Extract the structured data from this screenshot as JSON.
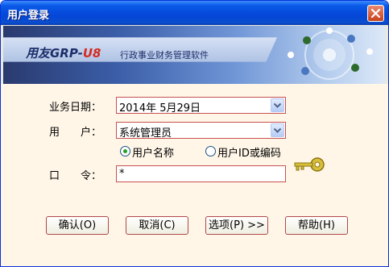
{
  "window": {
    "title": "用户登录"
  },
  "banner": {
    "logo_main": "用友GRP-",
    "logo_accent": "U8",
    "subtitle": "行政事业财务管理软件"
  },
  "form": {
    "date_label": "业务日期：",
    "date_value": "2014年 5月29日",
    "user_label": "用　　户：",
    "user_value": "系统管理员",
    "radio_name_label": "用户名称",
    "radio_id_label": "用户ID或编码",
    "radio_selected": "用户名称",
    "password_label": "口　　令：",
    "password_value": "*"
  },
  "buttons": {
    "ok": "确认(O)",
    "cancel": "取消(C)",
    "options": "选项(P) >>",
    "help": "帮助(H)"
  },
  "icons": {
    "close": "close-icon",
    "dropdown": "chevron-down-icon",
    "key": "key-icon"
  },
  "colors": {
    "title_bar": "#0a5ae8",
    "form_background": "#fff6e8",
    "field_border": "#c85050",
    "radio_dot": "#21a121",
    "logo_accent": "#d62a1e"
  }
}
